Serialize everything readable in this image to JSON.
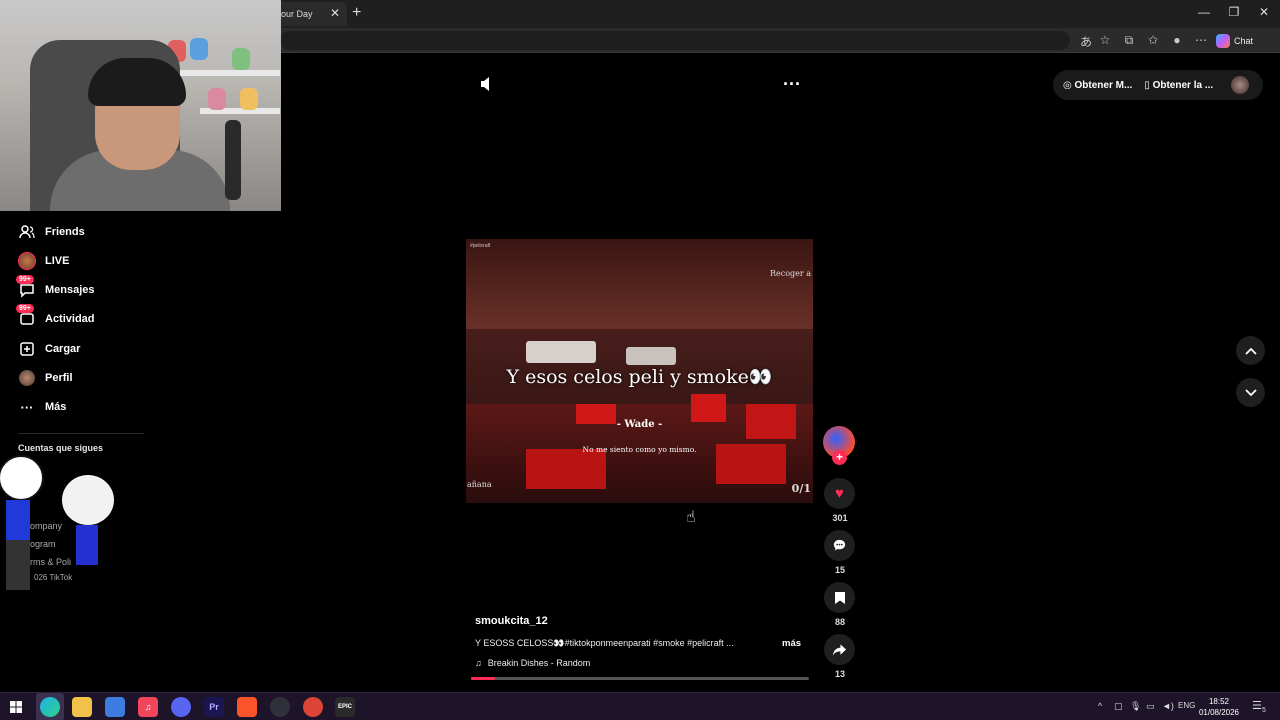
{
  "browser": {
    "tab_title": "our Day",
    "tab_close": "✕",
    "new_tab": "+",
    "chat_label": "Chat",
    "window_controls": [
      "—",
      "❐",
      "✕"
    ]
  },
  "sidebar": {
    "items": [
      {
        "label": "Friends",
        "icon": "friends-icon"
      },
      {
        "label": "LIVE",
        "icon": "live-icon"
      },
      {
        "label": "Mensajes",
        "icon": "messages-icon",
        "badge": "99+"
      },
      {
        "label": "Actividad",
        "icon": "activity-icon",
        "badge": "99+"
      },
      {
        "label": "Cargar",
        "icon": "upload-icon"
      },
      {
        "label": "Perfil",
        "icon": "profile-icon"
      },
      {
        "label": "Más",
        "icon": "more-icon"
      }
    ],
    "following_label": "Cuentas que sigues",
    "footer": [
      "ompany",
      "ogram",
      "rms & Poli",
      "026 TikTok"
    ]
  },
  "player": {
    "get_app_1": "Obtener M...",
    "get_app_2": "Obtener la ...",
    "video": {
      "caption": "Y esos celos peli y smoke👀",
      "name": "- Wade -",
      "subtitle": "No me siento como yo mismo.",
      "top_right": "Recoger a",
      "bottom_left": "añana",
      "counter": "0/1",
      "watermark": "#pelicraft"
    },
    "username": "smoukcita_12",
    "description": "Y ESOSS CELOSS👀#tiktokponmeenparati #smoke #pelicraft ...",
    "more_label": "más",
    "music": "Breakin Dishes - Random",
    "music_icon": "♫",
    "progress": 0.07,
    "actions": {
      "likes": "301",
      "comments": "15",
      "saves": "88",
      "shares": "13"
    }
  },
  "taskbar": {
    "apps": [
      "start",
      "edge",
      "files",
      "store",
      "music",
      "discord",
      "premiere",
      "brave",
      "obs",
      "chrome",
      "epic"
    ],
    "lang": "ENG",
    "time": "18:52",
    "date": "01/08/2026",
    "notifications": "5"
  },
  "colors": {
    "accent": "#fe2c55",
    "background": "#000000",
    "taskbar": "#1d1429"
  }
}
